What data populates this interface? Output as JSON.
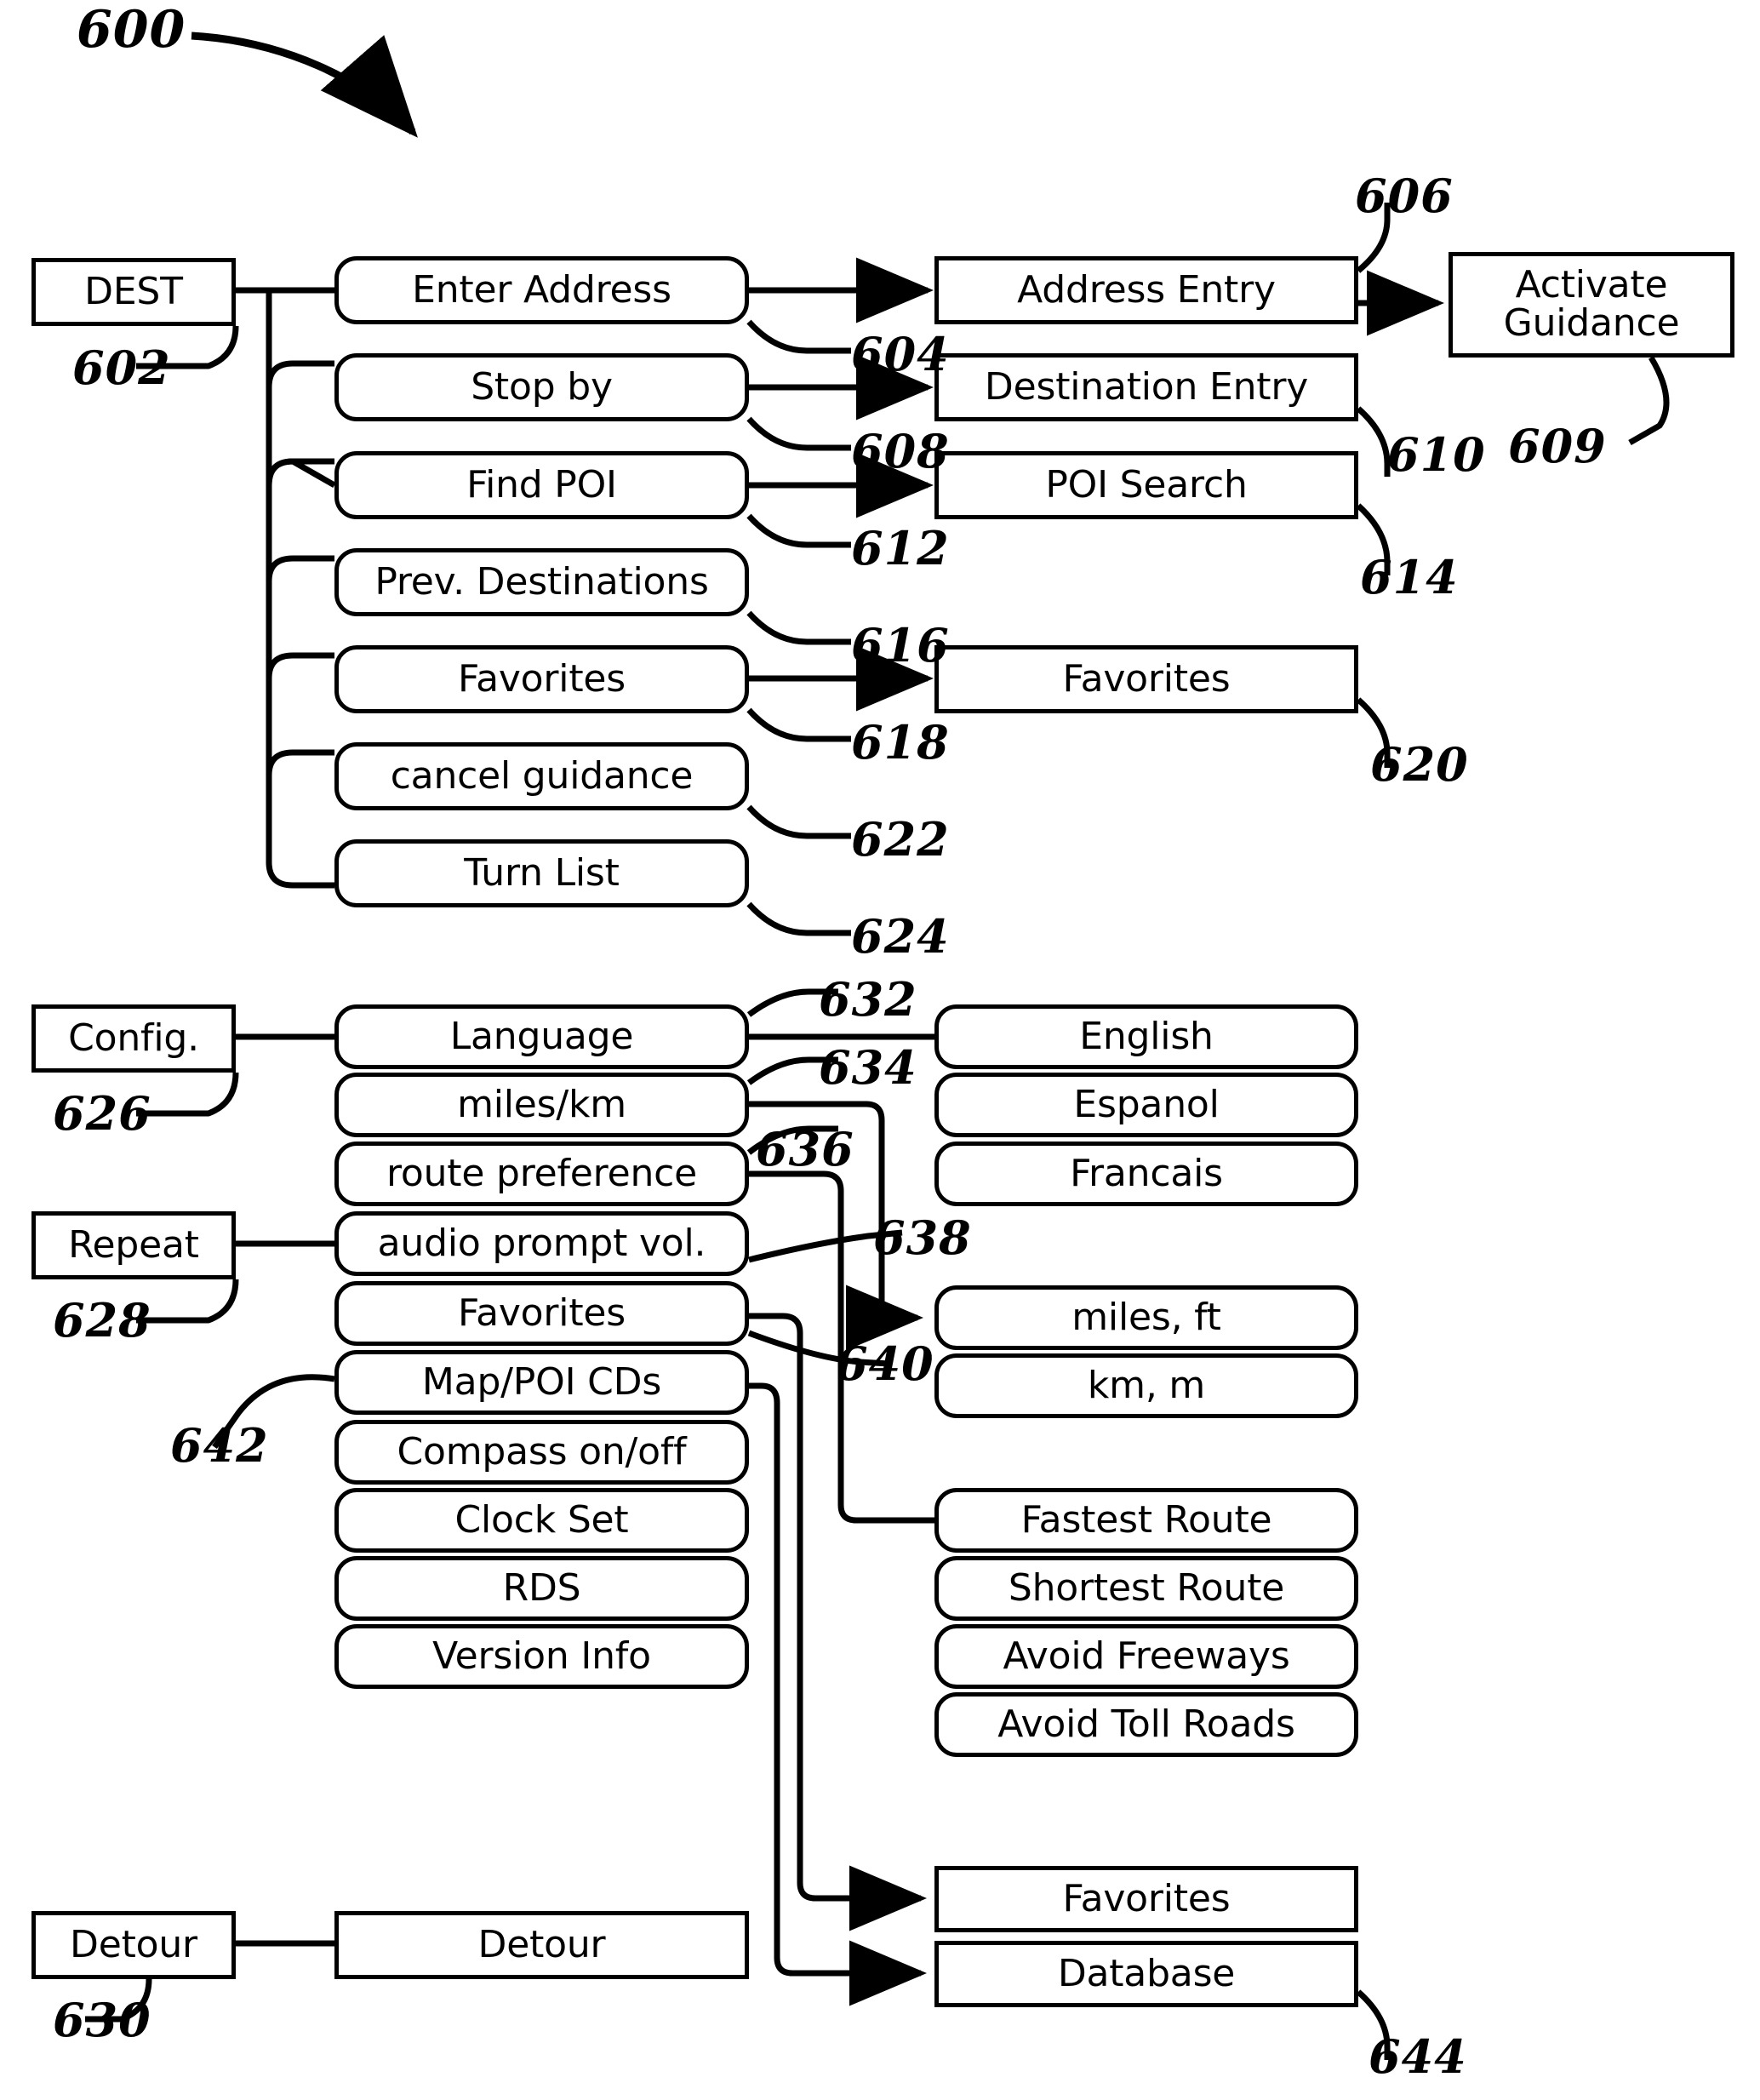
{
  "figure": {
    "number": "600",
    "type": "navigation-system-menu-hierarchy-diagram"
  },
  "nodes": {
    "dest_root": "DEST",
    "dest_menu": [
      "Enter Address",
      "Stop by",
      "Find POI",
      "Prev. Destinations",
      "Favorites",
      "cancel guidance",
      "Turn List"
    ],
    "dest_screens": [
      "Address Entry",
      "Destination Entry",
      "POI Search",
      "Favorites"
    ],
    "activate_guidance": "Activate\nGuidance",
    "activate_guidance_line1": "Activate",
    "activate_guidance_line2": "Guidance",
    "config_root": "Config.",
    "repeat_root": "Repeat",
    "detour_root": "Detour",
    "config_menu": [
      "Language",
      "miles/km",
      "route preference",
      "audio prompt vol.",
      "Favorites",
      "Map/POI CDs",
      "Compass on/off",
      "Clock Set",
      "RDS",
      "Version Info"
    ],
    "detour_menu": "Detour",
    "language_options": [
      "English",
      "Espanol",
      "Francais"
    ],
    "unit_options": [
      "miles, ft",
      "km, m"
    ],
    "route_options": [
      "Fastest Route",
      "Shortest Route",
      "Avoid Freeways",
      "Avoid Toll Roads"
    ],
    "favorites_screen": "Favorites",
    "database_screen": "Database"
  },
  "reference_numerals": {
    "fig": "600",
    "dest": "602",
    "enter_address": "604",
    "address_entry": "606",
    "stop_by": "608",
    "activate_guidance": "609",
    "destination_entry": "610",
    "find_poi": "612",
    "poi_search": "614",
    "prev_destinations": "616",
    "favorites_menu": "618",
    "favorites_screen": "620",
    "cancel_guidance": "622",
    "turn_list": "624",
    "config": "626",
    "repeat": "628",
    "detour": "630",
    "language": "632",
    "miles_km": "634",
    "route_preference": "636",
    "audio_prompt_vol": "638",
    "favorites_config": "640",
    "map_poi_cds": "642",
    "database": "644"
  },
  "colors": {
    "stroke": "#000000",
    "background": "#ffffff"
  }
}
